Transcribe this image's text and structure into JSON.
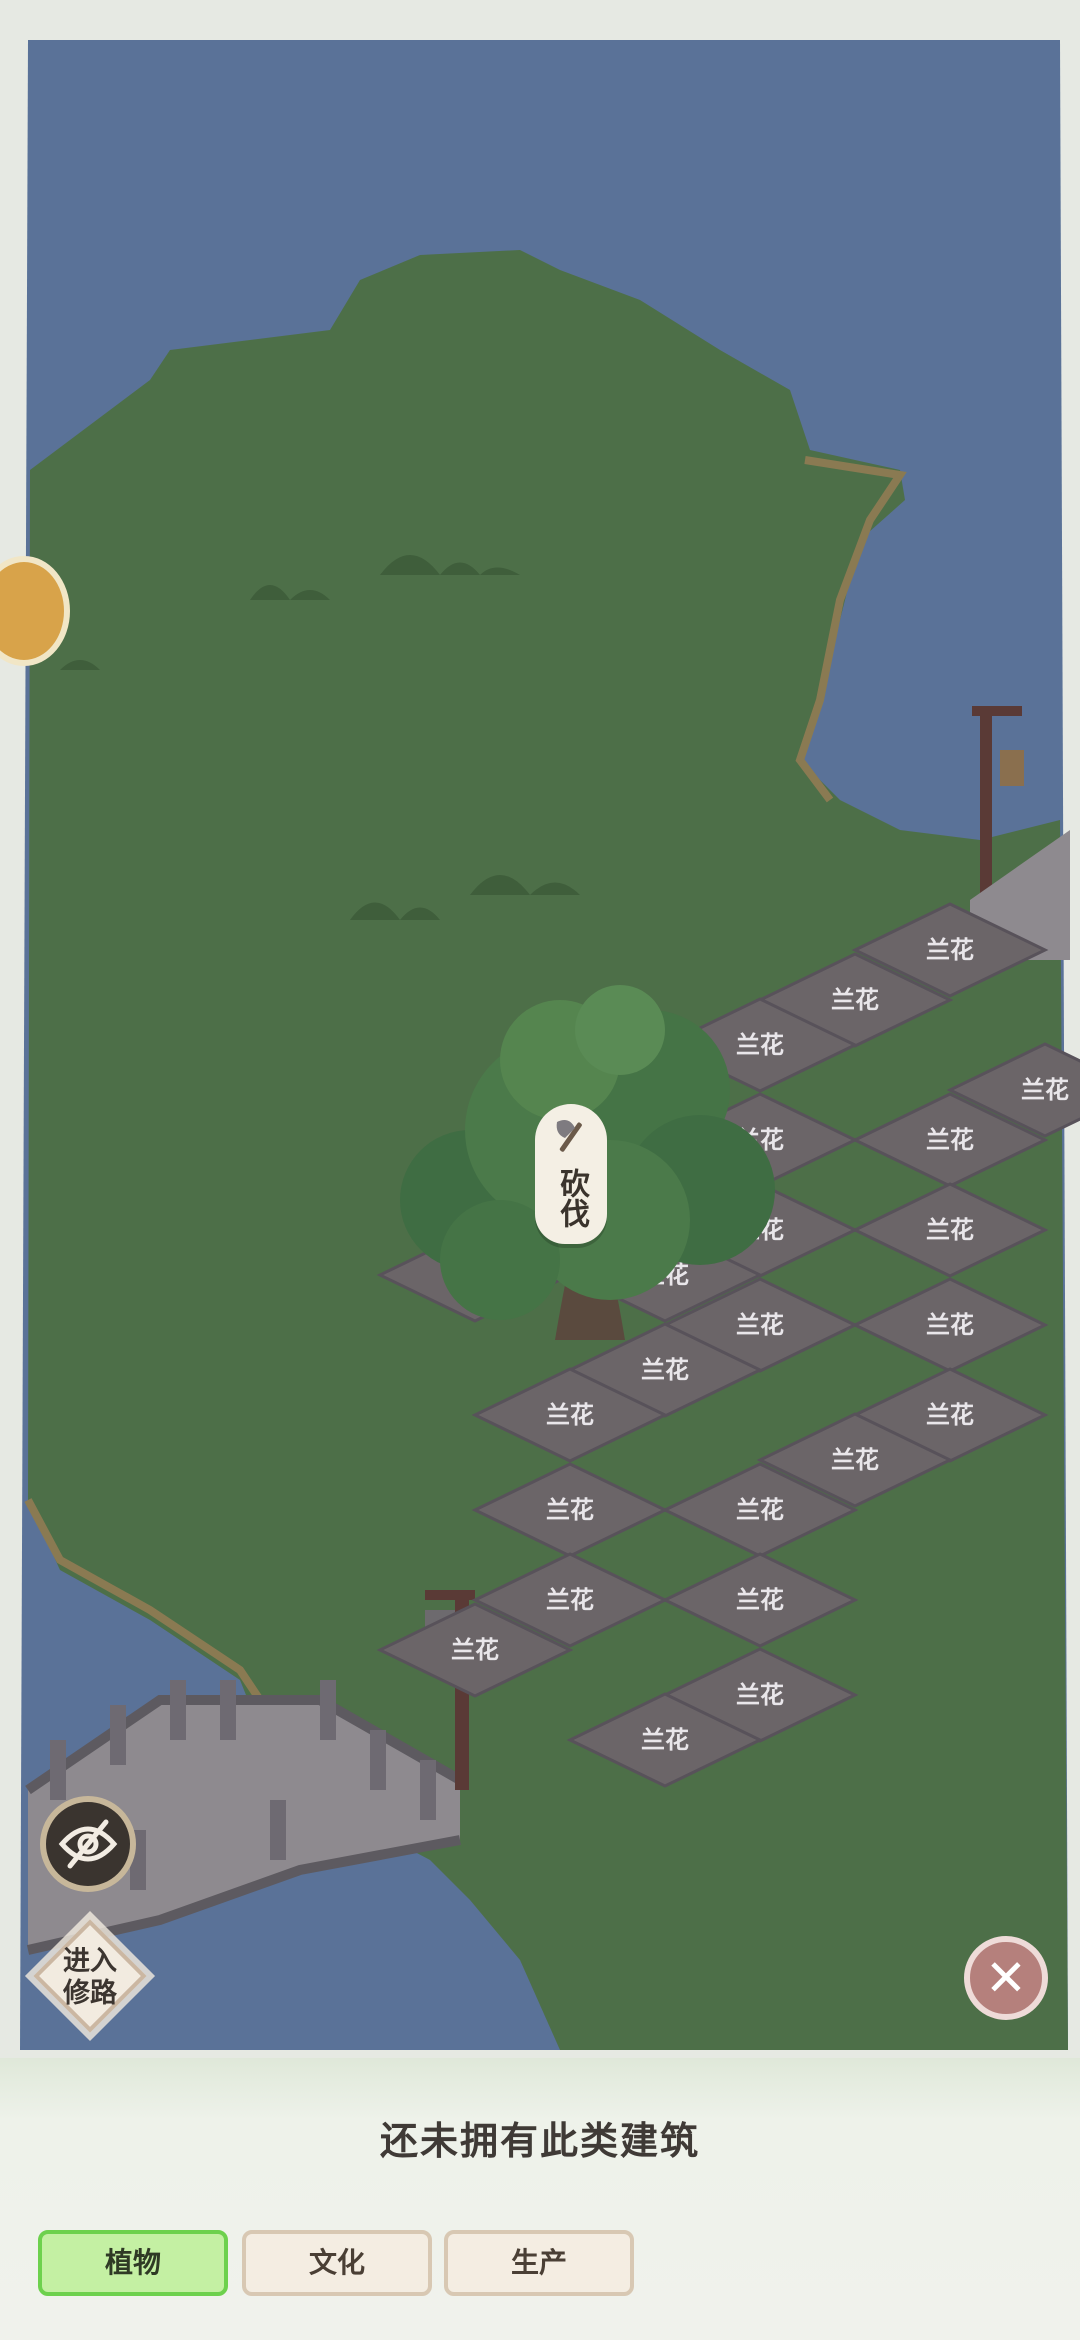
{
  "map": {
    "tiles": [
      {
        "label": "兰花"
      },
      {
        "label": "兰花"
      },
      {
        "label": "兰花"
      },
      {
        "label": "兰花"
      },
      {
        "label": "兰花"
      },
      {
        "label": "兰花"
      },
      {
        "label": "兰花"
      },
      {
        "label": "兰花"
      },
      {
        "label": "兰花"
      },
      {
        "label": "兰花"
      },
      {
        "label": "兰花"
      },
      {
        "label": "兰花"
      },
      {
        "label": "兰花"
      },
      {
        "label": "兰花"
      },
      {
        "label": "兰花"
      },
      {
        "label": "兰花"
      },
      {
        "label": "兰花"
      },
      {
        "label": "兰花"
      },
      {
        "label": "兰花"
      },
      {
        "label": "兰花"
      },
      {
        "label": "兰花"
      },
      {
        "label": "兰花"
      },
      {
        "label": "兰花"
      }
    ],
    "tree_action": "砍伐"
  },
  "controls": {
    "road_button": "进入\n修路",
    "road_button_line1": "进入",
    "road_button_line2": "修路",
    "close_icon": "close-icon",
    "hide_icon": "eye-off-icon"
  },
  "panel": {
    "empty_message": "还未拥有此类建筑",
    "tabs": [
      {
        "label": "植物",
        "active": true
      },
      {
        "label": "文化",
        "active": false
      },
      {
        "label": "生产",
        "active": false
      }
    ]
  },
  "colors": {
    "water": "#5a7298",
    "grass": "#4d6f48",
    "tile": "#6b6568",
    "tab_active_bg": "#c4f0a3",
    "tab_active_border": "#6dd14d"
  }
}
